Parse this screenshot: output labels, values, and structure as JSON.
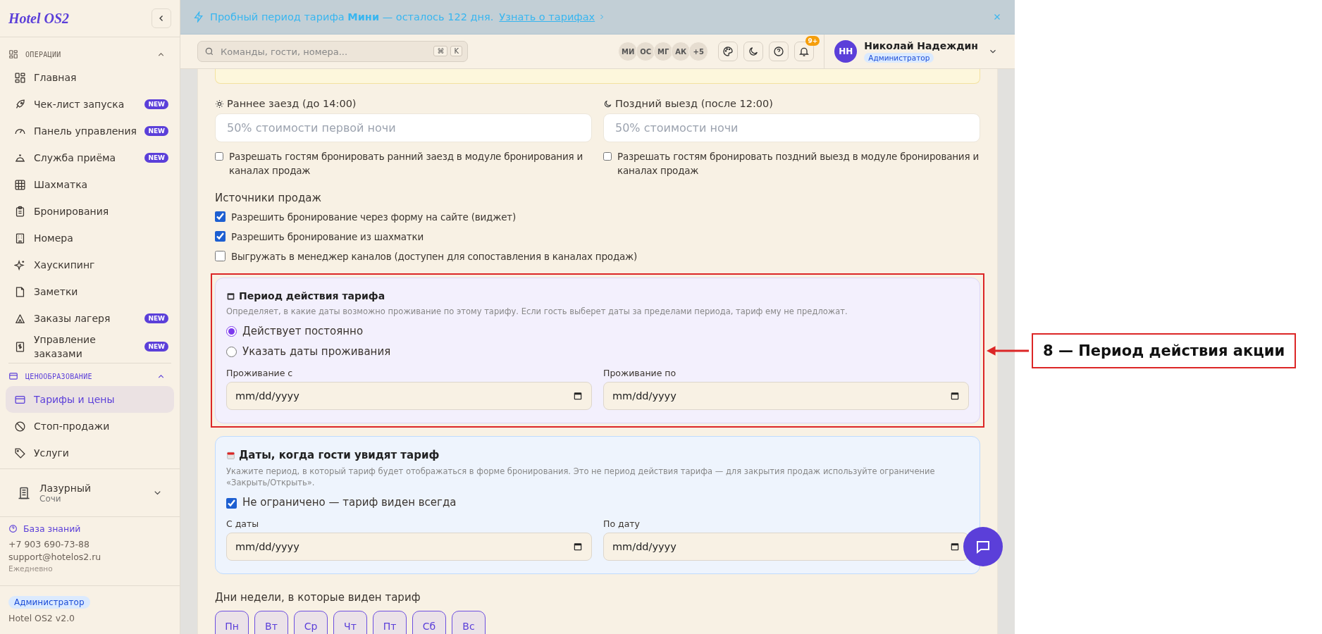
{
  "sidebar": {
    "logo": "Hotel OS2",
    "sections": [
      {
        "title": "ОПЕРАЦИИ",
        "selected": false,
        "expanded": true,
        "items": [
          {
            "label": "Главная",
            "selected": false
          },
          {
            "label": "Чек-лист запуска",
            "badge": "NEW",
            "selected": false
          },
          {
            "label": "Панель управления",
            "badge": "NEW",
            "selected": false
          },
          {
            "label": "Служба приёма",
            "badge": "NEW",
            "selected": false
          },
          {
            "label": "Шахматка",
            "selected": false
          },
          {
            "label": "Бронирования",
            "selected": false
          },
          {
            "label": "Номера",
            "selected": false
          },
          {
            "label": "Хаускипинг",
            "selected": false
          },
          {
            "label": "Заметки",
            "selected": false
          },
          {
            "label": "Заказы лагеря",
            "badge": "NEW",
            "selected": false
          },
          {
            "label": "Управление заказами",
            "badge": "NEW",
            "selected": false
          }
        ]
      },
      {
        "title": "ЦЕНООБРАЗОВАНИЕ",
        "selected": true,
        "expanded": true,
        "items": [
          {
            "label": "Тарифы и цены",
            "selected": true
          },
          {
            "label": "Стоп-продажи",
            "selected": false
          },
          {
            "label": "Услуги",
            "selected": false
          }
        ]
      }
    ],
    "property": {
      "name": "Лазурный",
      "city": "Сочи"
    },
    "support": {
      "link": "База знаний",
      "phone": "+7 903 690-73-88",
      "email": "support@hotelos2.ru",
      "hours": "Ежедневно"
    },
    "footer": {
      "role": "Администратор",
      "version": "Hotel OS2 v2.0"
    }
  },
  "banner": {
    "text": "Пробный период тарифа **Мини** — осталось 122 дня.",
    "link": "Узнать о тарифах"
  },
  "topbar": {
    "search": {
      "placeholder": "Команды, гости, номера...",
      "keys": [
        "⌘",
        "K"
      ]
    },
    "avatars": [
      "МИ",
      "ОС",
      "МГ",
      "АК"
    ],
    "more": "+5",
    "notifications": "9+",
    "user": {
      "initials": "НН",
      "name": "Николай Надеждин",
      "role": "Администратор"
    }
  },
  "form": {
    "extras": [
      {
        "label": "Раннее заезд (до 14:00)",
        "placeholder": "50% стоимости первой ночи",
        "option": {
          "label": "Разрешать гостям бронировать ранний заезд в модуле бронирования и каналах продаж",
          "checked": false
        }
      },
      {
        "label": "Поздний выезд (после 12:00)",
        "placeholder": "50% стоимости ночи",
        "option": {
          "label": "Разрешать гостям бронировать поздний выезд в модуле бронирования и каналах продаж",
          "checked": false
        }
      }
    ],
    "sources": {
      "title": "Источники продаж",
      "options": [
        {
          "label": "Разрешить бронирование через форму на сайте (виджет)",
          "checked": true
        },
        {
          "label": "Разрешить бронирование из шахматки",
          "checked": true
        },
        {
          "label": "Выгружать в менеджер каналов (доступен для сопоставления в каналах продаж)",
          "checked": false
        }
      ]
    },
    "period": {
      "title": "Период действия тарифа",
      "description": "Определяет, в какие даты возможно проживание по этому тарифу. Если гость выберет даты за пределами периода, тариф ему не предложат.",
      "radios": [
        {
          "label": "Действует постоянно",
          "selected": true
        },
        {
          "label": "Указать даты проживания",
          "selected": false
        }
      ],
      "dates": [
        {
          "label": "Проживание с",
          "placeholder": "mm/dd/yyyy"
        },
        {
          "label": "Проживание по",
          "placeholder": "mm/dd/yyyy"
        }
      ]
    },
    "visibility": {
      "title": "Даты, когда гости увидят тариф",
      "description": "Укажите период, в который тариф будет отображаться в форме бронирования. Это не период действия тарифа — для закрытия продаж используйте ограничение «Закрыть/Открыть».",
      "unlimited": {
        "label": "Не ограничено — тариф виден всегда",
        "checked": true
      },
      "dates": [
        {
          "label": "С даты",
          "placeholder": "mm/dd/yyyy"
        },
        {
          "label": "По дату",
          "placeholder": "mm/dd/yyyy"
        }
      ]
    },
    "weekdays": {
      "title": "Дни недели, в которые виден тариф",
      "days": [
        {
          "label": "Пн",
          "selected": true
        },
        {
          "label": "Вт",
          "selected": true
        },
        {
          "label": "Ср",
          "selected": true
        },
        {
          "label": "Чт",
          "selected": true
        },
        {
          "label": "Пт",
          "selected": true
        },
        {
          "label": "Сб",
          "selected": true
        },
        {
          "label": "Вс",
          "selected": true
        }
      ]
    }
  },
  "annotation": {
    "text": "8 — Период действия акции"
  }
}
